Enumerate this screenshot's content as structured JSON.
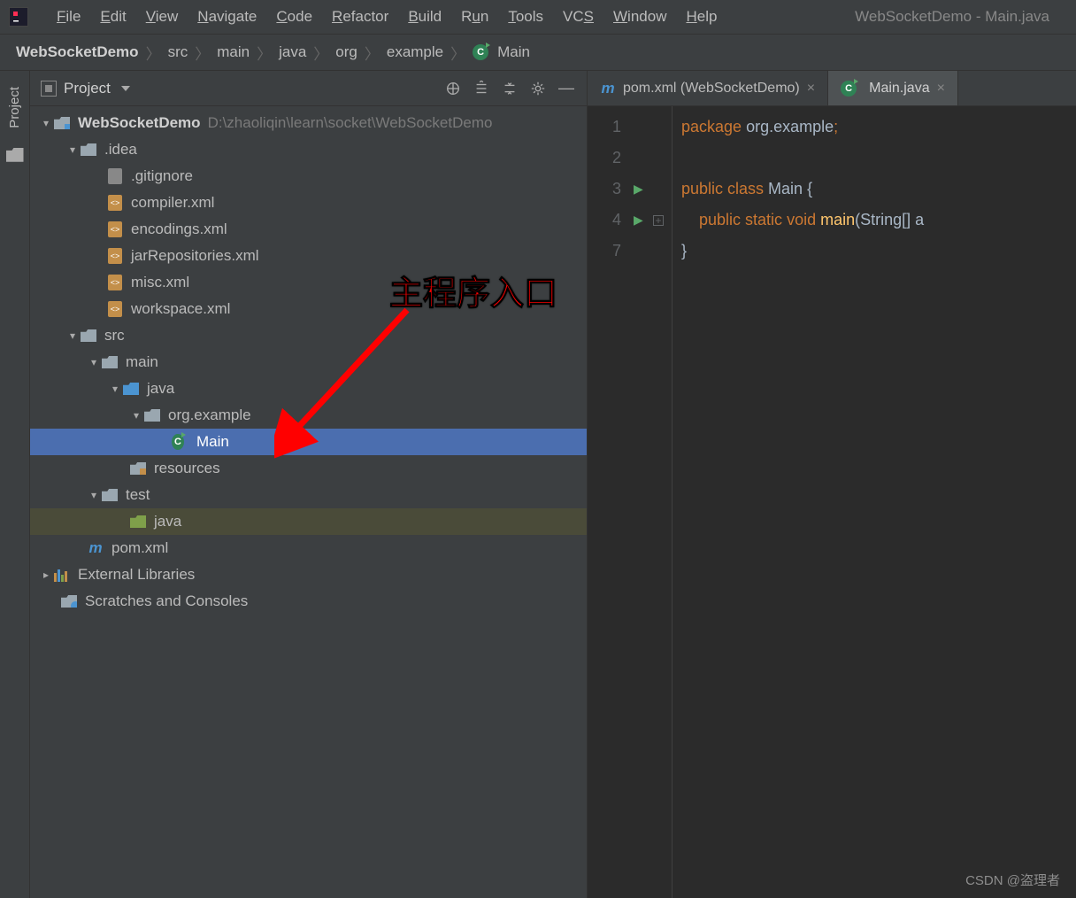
{
  "window": {
    "title": "WebSocketDemo - Main.java"
  },
  "menu": {
    "file": "File",
    "edit": "Edit",
    "view": "View",
    "navigate": "Navigate",
    "code": "Code",
    "refactor": "Refactor",
    "build": "Build",
    "run": "Run",
    "tools": "Tools",
    "vcs": "VCS",
    "window": "Window",
    "help": "Help"
  },
  "breadcrumb": {
    "root": "WebSocketDemo",
    "src": "src",
    "main": "main",
    "java": "java",
    "org": "org",
    "example": "example",
    "cls": "Main"
  },
  "leftGutter": {
    "projectTab": "Project"
  },
  "projectPanel": {
    "title": "Project",
    "tree": {
      "root": "WebSocketDemo",
      "rootPath": "D:\\zhaoliqin\\learn\\socket\\WebSocketDemo",
      "idea": ".idea",
      "gitignore": ".gitignore",
      "compiler": "compiler.xml",
      "encodings": "encodings.xml",
      "jarRepos": "jarRepositories.xml",
      "misc": "misc.xml",
      "workspace": "workspace.xml",
      "src": "src",
      "main": "main",
      "java": "java",
      "pkg": "org.example",
      "mainCls": "Main",
      "resources": "resources",
      "test": "test",
      "testJava": "java",
      "pom": "pom.xml",
      "extLibs": "External Libraries",
      "scratch": "Scratches and Consoles"
    }
  },
  "editor": {
    "tabs": {
      "pom": "pom.xml (WebSocketDemo)",
      "main": "Main.java"
    },
    "lines": [
      "1",
      "2",
      "3",
      "4",
      "7"
    ],
    "code": {
      "l1_kw": "package",
      "l1_pkg": " org.example",
      "l1_semi": ";",
      "l3_pub": "public ",
      "l3_cls": "class ",
      "l3_name": "Main ",
      "l3_brace": "{",
      "l4_pub": "public ",
      "l4_static": "static ",
      "l4_void": "void ",
      "l4_main": "main",
      "l4_sig": "(String[] a",
      "l7_brace": "}"
    }
  },
  "annotation": {
    "text": "主程序入口"
  },
  "watermark": "CSDN @盗理者"
}
